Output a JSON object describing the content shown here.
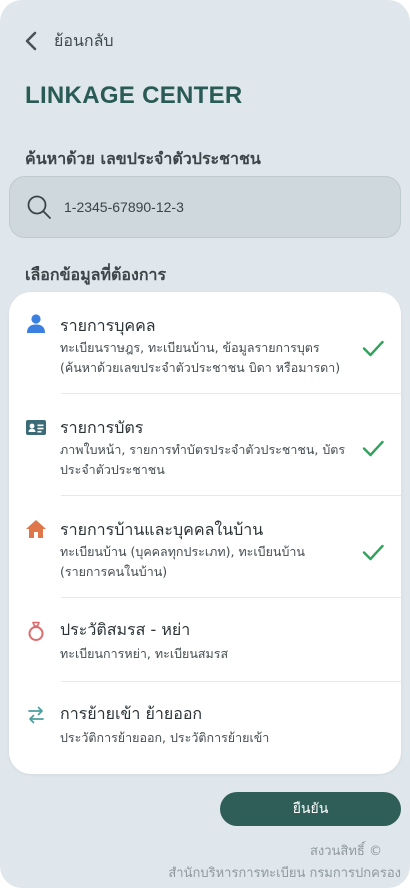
{
  "header": {
    "back_label": "ย้อนกลับ",
    "title": "LINKAGE CENTER"
  },
  "search": {
    "label": "ค้นหาด้วย เลขประจำตัวประชาชน",
    "value": "1-2345-67890-12-3"
  },
  "options": {
    "label": "เลือกข้อมูลที่ต้องการ",
    "items": [
      {
        "title": "รายการบุคคล",
        "desc": "ทะเบียนราษฎร, ทะเบียนบ้าน, ข้อมูลรายการบุตร (ค้นหาด้วยเลขประจำตัวประชาชน บิดา หรือมารดา)",
        "icon": "person-icon",
        "selected": true
      },
      {
        "title": "รายการบัตร",
        "desc": "ภาพใบหน้า, รายการทำบัตรประจำตัวประชาชน, บัตรประจำตัวประชาชน",
        "icon": "id-card-icon",
        "selected": true
      },
      {
        "title": "รายการบ้านและบุคคลในบ้าน",
        "desc": "ทะเบียนบ้าน (บุคคลทุกประเภท), ทะเบียนบ้าน (รายการคนในบ้าน)",
        "icon": "house-icon",
        "selected": true
      },
      {
        "title": "ประวัติสมรส - หย่า",
        "desc": "ทะเบียนการหย่า, ทะเบียนสมรส",
        "icon": "ring-icon",
        "selected": false
      },
      {
        "title": "การย้ายเข้า ย้ายออก",
        "desc": "ประวัติการย้ายออก, ประวัติการย้ายเข้า",
        "icon": "transfer-arrows-icon",
        "selected": false
      }
    ]
  },
  "footer": {
    "confirm_label": "ยืนยัน",
    "copyright": "สงวนสิทธิ์ ©",
    "organization": "สำนักบริหารการทะเบียน กรมการปกครอง"
  },
  "colors": {
    "background": "#dfe7ec",
    "title": "#2a5a56",
    "confirm_button": "#2f5e58",
    "check": "#2fa35a",
    "person_icon": "#3b7fe0",
    "card_icon": "#3c6b78",
    "house_icon": "#e0774a",
    "ring_icon": "#e06a6a",
    "transfer_icon": "#4a9fa0"
  }
}
